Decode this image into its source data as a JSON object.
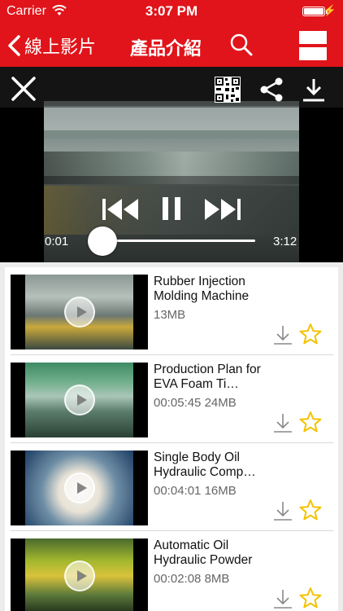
{
  "status": {
    "carrier": "Carrier",
    "time": "3:07 PM"
  },
  "nav": {
    "back_label": "線上影片",
    "title": "產品介紹"
  },
  "player": {
    "current_time": "0:01",
    "total_time": "3:12",
    "progress": 0.01
  },
  "colors": {
    "brand_red": "#e0141a",
    "star": "#f2c200"
  },
  "videos": [
    {
      "title": "Rubber Injection Molding Machine",
      "duration": "",
      "size": "13MB"
    },
    {
      "title": "Production Plan for EVA Foam Ti…",
      "duration": "00:05:45",
      "size": "24MB"
    },
    {
      "title": "Single Body Oil Hydraulic Comp…",
      "duration": "00:04:01",
      "size": "16MB"
    },
    {
      "title": "Automatic Oil Hydraulic Powder",
      "duration": "00:02:08",
      "size": "8MB"
    }
  ]
}
